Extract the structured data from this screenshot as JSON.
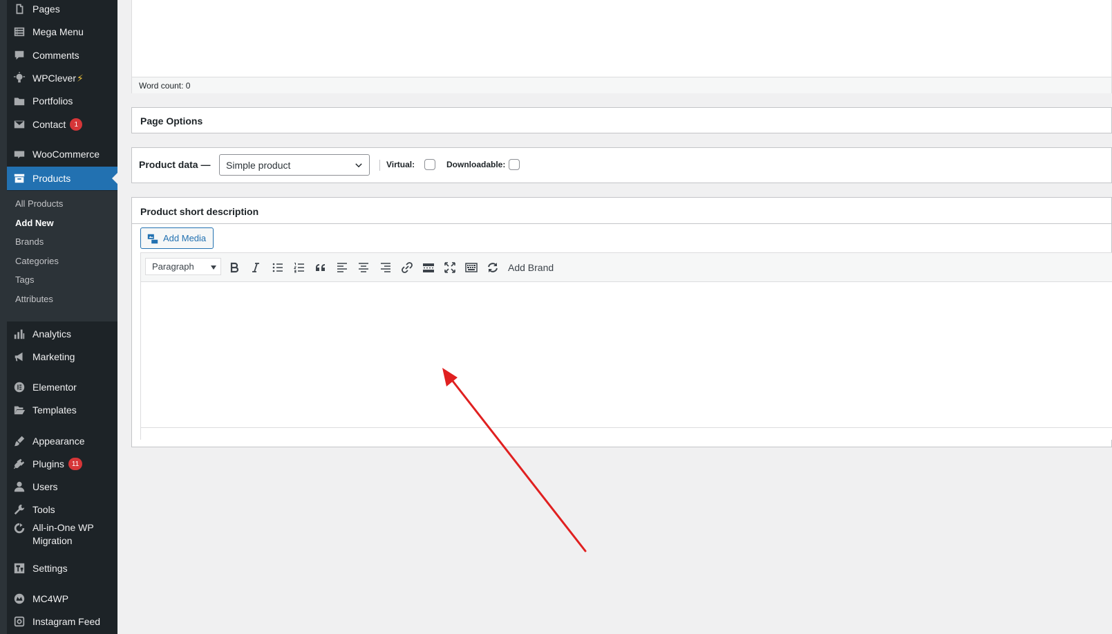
{
  "sidebar": {
    "items": [
      {
        "label": "Pages",
        "icon": "pages-icon"
      },
      {
        "label": "Mega Menu",
        "icon": "menu-list-icon"
      },
      {
        "label": "Comments",
        "icon": "comments-icon"
      },
      {
        "label": "WPClever",
        "icon": "lightbulb-icon",
        "suffix": "⚡"
      },
      {
        "label": "Portfolios",
        "icon": "folder-icon"
      },
      {
        "label": "Contact",
        "icon": "mail-icon",
        "badge": "1"
      },
      {
        "label": "WooCommerce",
        "icon": "woo-icon"
      },
      {
        "label": "Products",
        "icon": "archive-icon"
      },
      {
        "label": "Analytics",
        "icon": "bar-chart-icon"
      },
      {
        "label": "Marketing",
        "icon": "megaphone-icon"
      },
      {
        "label": "Elementor",
        "icon": "elementor-icon"
      },
      {
        "label": "Templates",
        "icon": "folder-open-icon"
      },
      {
        "label": "Appearance",
        "icon": "paintbrush-icon"
      },
      {
        "label": "Plugins",
        "icon": "plug-icon",
        "badge": "11"
      },
      {
        "label": "Users",
        "icon": "user-icon"
      },
      {
        "label": "Tools",
        "icon": "wrench-icon"
      },
      {
        "label": "All-in-One WP Migration",
        "icon": "migration-icon"
      },
      {
        "label": "Settings",
        "icon": "settings-icon"
      },
      {
        "label": "MC4WP",
        "icon": "mc4wp-icon"
      },
      {
        "label": "Instagram Feed",
        "icon": "instagram-icon"
      }
    ],
    "products_submenu": [
      "All Products",
      "Add New",
      "Brands",
      "Categories",
      "Tags",
      "Attributes"
    ],
    "active_item": "Products",
    "current_subitem": "Add New"
  },
  "editor": {
    "word_count": "Word count: 0"
  },
  "page_options": {
    "title": "Page Options"
  },
  "product_data": {
    "label": "Product data —",
    "type_selected": "Simple product",
    "virtual_label": "Virtual:",
    "virtual_checked": false,
    "downloadable_label": "Downloadable:",
    "downloadable_checked": false
  },
  "short_description": {
    "title": "Product short description",
    "add_media_label": "Add Media",
    "format_selected": "Paragraph",
    "toolbar_buttons": [
      "bold-icon",
      "italic-icon",
      "bullet-list-icon",
      "numbered-list-icon",
      "blockquote-icon",
      "align-left-icon",
      "align-center-icon",
      "align-right-icon",
      "link-icon",
      "read-more-icon",
      "fullscreen-icon",
      "toolbar-toggle-icon",
      "refresh-icon"
    ],
    "add_brand_label": "Add Brand",
    "content": ""
  },
  "colors": {
    "sidebar_bg": "#1d2327",
    "active_bg": "#2271b1",
    "badge_bg": "#d63638",
    "annotation_arrow": "#e02020"
  }
}
